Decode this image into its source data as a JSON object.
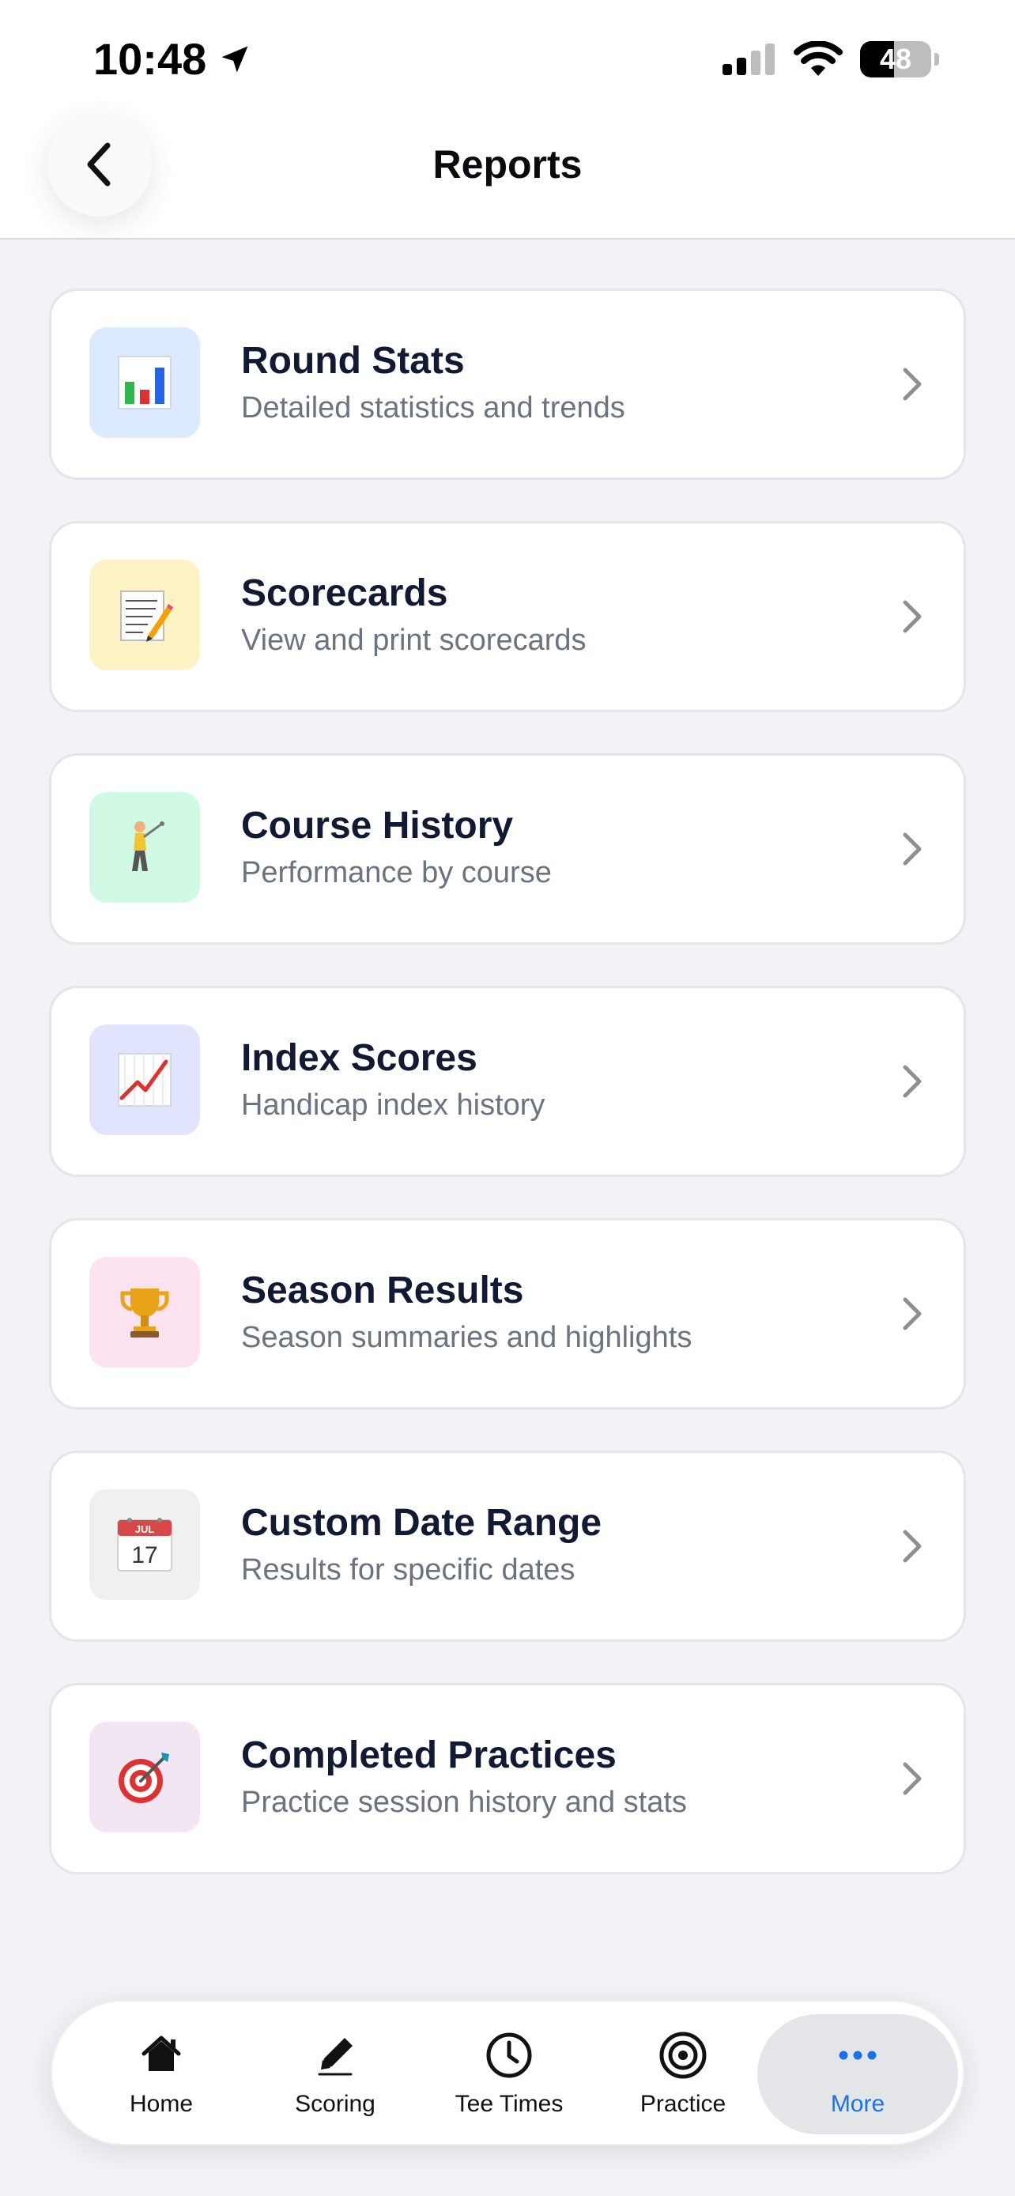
{
  "status": {
    "time": "10:48",
    "battery": "48",
    "battery_level": 0.48
  },
  "header": {
    "title": "Reports",
    "back_icon": "chevron-left-icon"
  },
  "reports": [
    {
      "title": "Round Stats",
      "subtitle": "Detailed statistics and trends",
      "icon": "bar-chart-icon",
      "tile_color": "#dbeafe"
    },
    {
      "title": "Scorecards",
      "subtitle": "View and print scorecards",
      "icon": "memo-icon",
      "tile_color": "#fdf3c4"
    },
    {
      "title": "Course History",
      "subtitle": "Performance by course",
      "icon": "golfer-icon",
      "tile_color": "#d1fae5"
    },
    {
      "title": "Index Scores",
      "subtitle": "Handicap index history",
      "icon": "trend-up-chart-icon",
      "tile_color": "#e0e4fd"
    },
    {
      "title": "Season Results",
      "subtitle": "Season summaries and highlights",
      "icon": "trophy-icon",
      "tile_color": "#fce3ef"
    },
    {
      "title": "Custom Date Range",
      "subtitle": "Results for specific dates",
      "icon": "calendar-icon",
      "tile_color": "#f0f0f2",
      "calendar_month": "JUL",
      "calendar_day": "17"
    },
    {
      "title": "Completed Practices",
      "subtitle": "Practice session history and stats",
      "icon": "target-dart-icon",
      "tile_color": "#f3e6f3"
    }
  ],
  "tabs": [
    {
      "label": "Home",
      "icon": "home-icon",
      "active": false
    },
    {
      "label": "Scoring",
      "icon": "pencil-icon",
      "active": false
    },
    {
      "label": "Tee Times",
      "icon": "clock-icon",
      "active": false
    },
    {
      "label": "Practice",
      "icon": "target-icon",
      "active": false
    },
    {
      "label": "More",
      "icon": "ellipsis-icon",
      "active": true
    }
  ],
  "colors": {
    "accent": "#1a73e8",
    "title_text": "#101a33",
    "subtitle_text": "#6b7280",
    "background": "#f2f2f7"
  }
}
